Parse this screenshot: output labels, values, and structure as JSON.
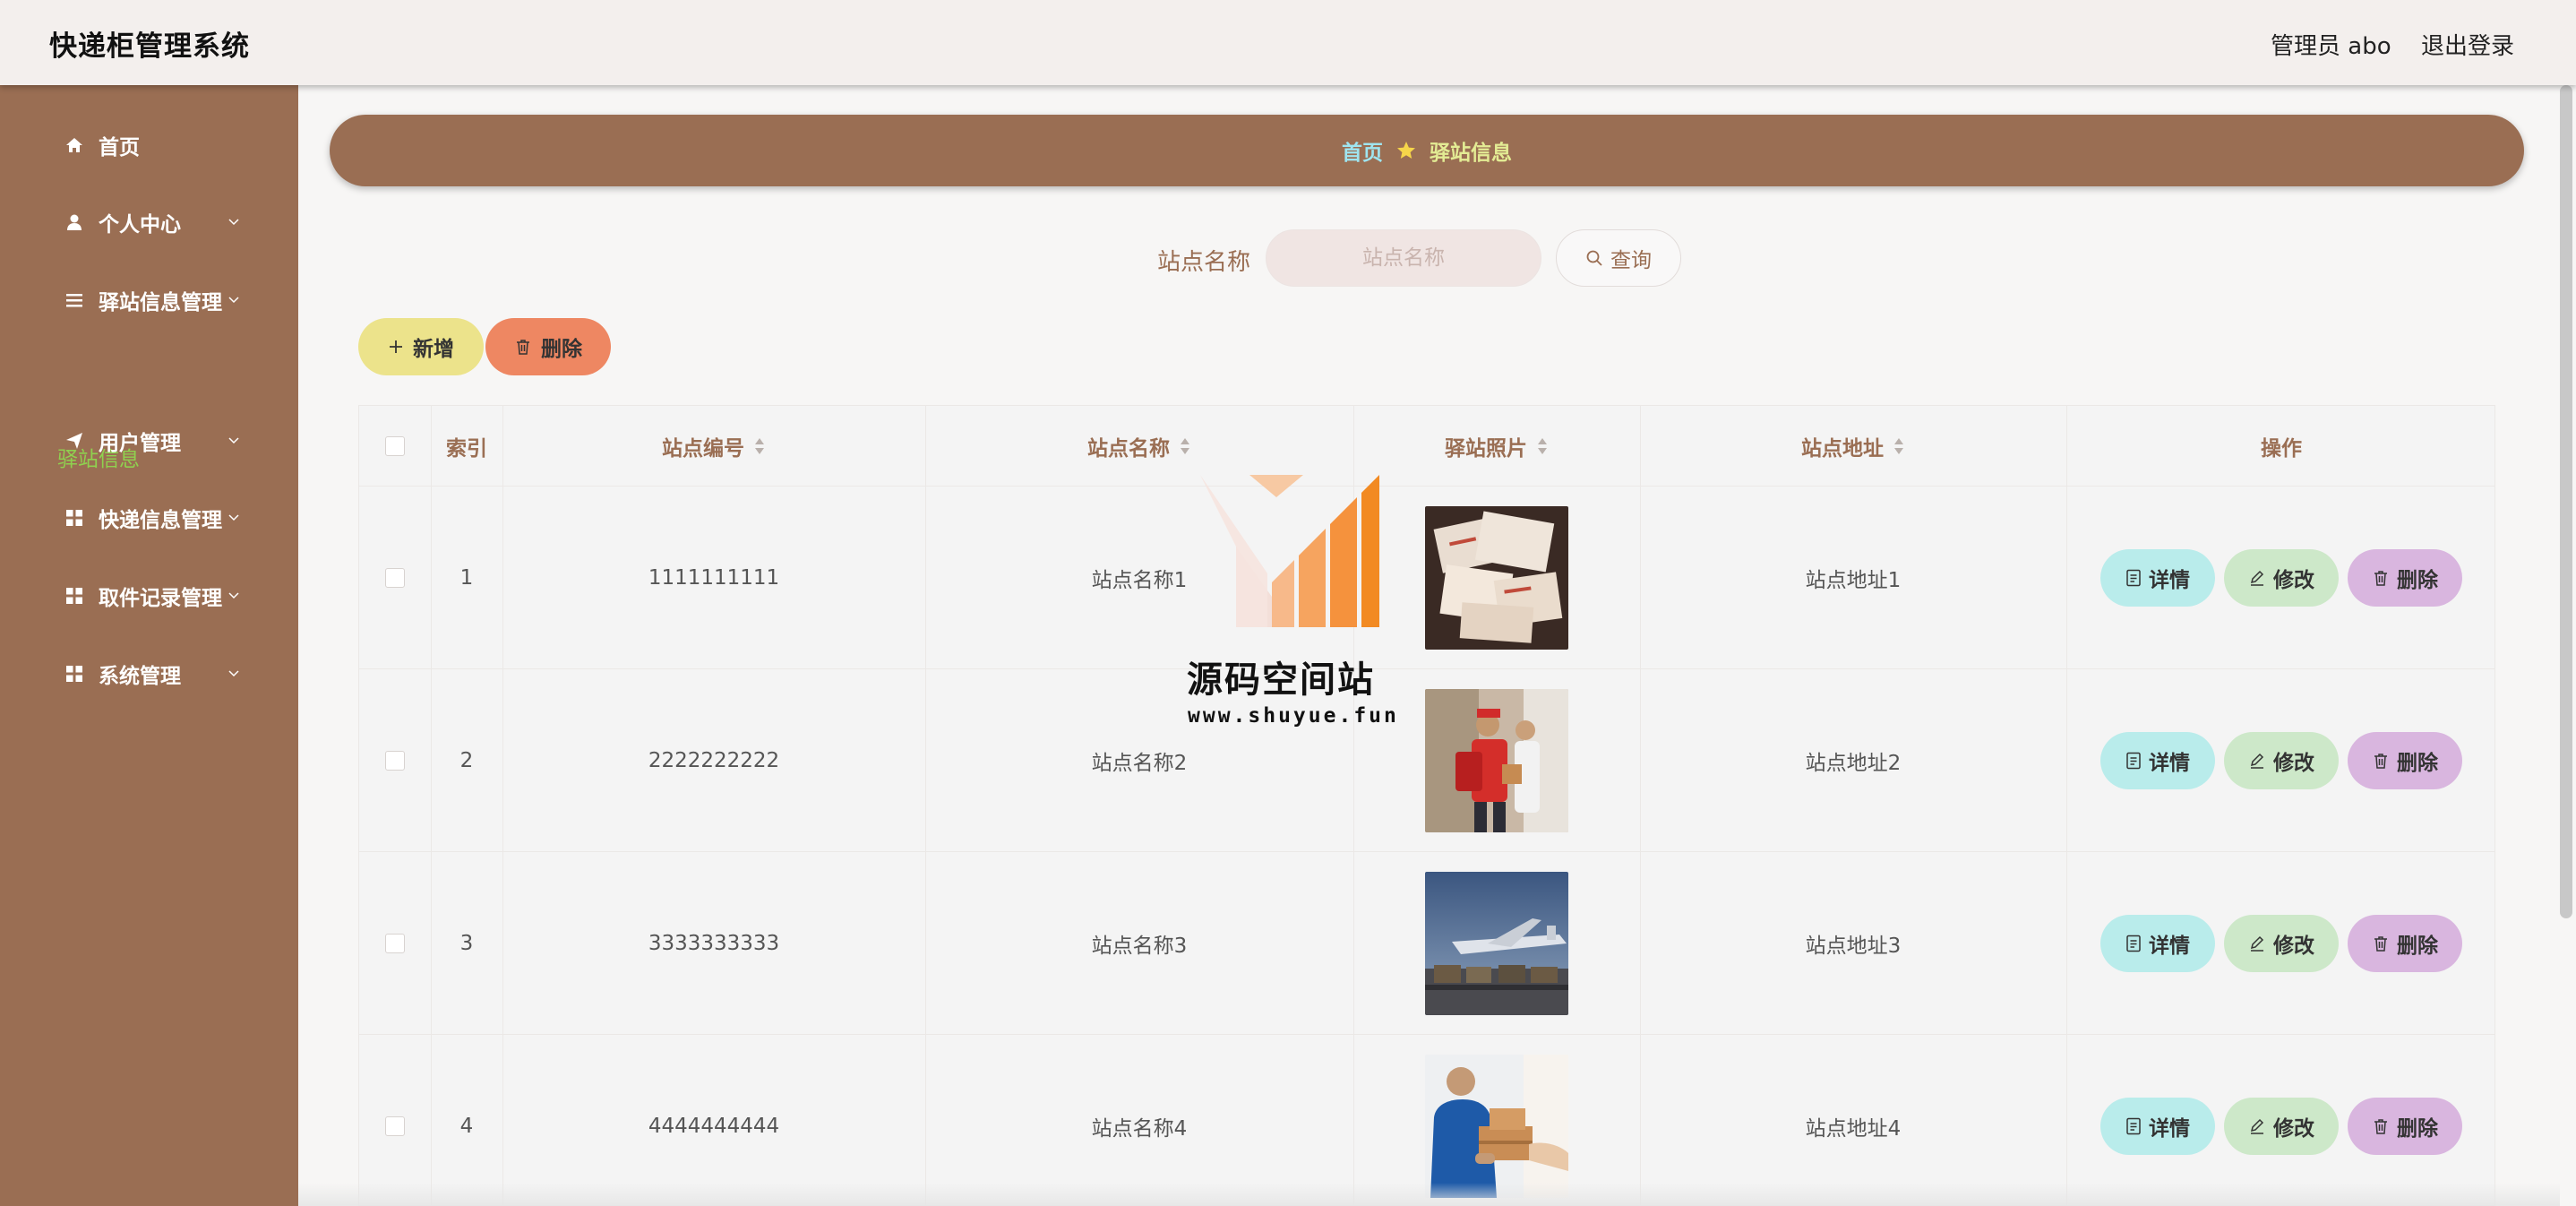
{
  "header": {
    "title": "快递柜管理系统",
    "admin": "管理员 abo",
    "logout": "退出登录"
  },
  "sidebar": {
    "items": [
      {
        "label": "首页",
        "icon": "home-icon",
        "chevron": false
      },
      {
        "label": "个人中心",
        "icon": "user-icon",
        "chevron": true
      },
      {
        "label": "驿站信息管理",
        "icon": "list-icon",
        "chevron": true
      },
      {
        "label": "用户管理",
        "icon": "send-icon",
        "chevron": true
      },
      {
        "label": "快递信息管理",
        "icon": "grid-icon",
        "chevron": true
      },
      {
        "label": "取件记录管理",
        "icon": "grid-icon",
        "chevron": true
      },
      {
        "label": "系统管理",
        "icon": "grid-icon",
        "chevron": true
      }
    ],
    "active_sub": "驿站信息",
    "active_sub_color": "#8fd14f"
  },
  "breadcrumb": {
    "home": "首页",
    "current": "驿站信息"
  },
  "search": {
    "label": "站点名称",
    "placeholder": "站点名称",
    "button": "查询"
  },
  "toolbar": {
    "add": "新增",
    "delete": "删除"
  },
  "table": {
    "headers": {
      "index": "索引",
      "code": "站点编号",
      "name": "站点名称",
      "photo": "驿站照片",
      "address": "站点地址",
      "actions": "操作"
    },
    "rows": [
      {
        "index": "1",
        "code": "1111111111",
        "name": "站点名称1",
        "address": "站点地址1",
        "photo": "parcels-photo"
      },
      {
        "index": "2",
        "code": "2222222222",
        "name": "站点名称2",
        "address": "站点地址2",
        "photo": "courier-photo"
      },
      {
        "index": "3",
        "code": "3333333333",
        "name": "站点名称3",
        "address": "站点地址3",
        "photo": "airport-cargo-photo"
      },
      {
        "index": "4",
        "code": "4444444444",
        "name": "站点名称4",
        "address": "站点地址4",
        "photo": "delivery-handover-photo"
      }
    ],
    "actions": {
      "detail": "详情",
      "edit": "修改",
      "delete": "删除"
    }
  },
  "watermark": {
    "title": "源码空间站",
    "url": "www.shuyue.fun"
  },
  "colors": {
    "brand": "#9a6e53",
    "add": "#ece38b",
    "delete": "#ee8762",
    "detail": "#b9eceb",
    "edit": "#cde8c9",
    "row_delete": "#d9b6df"
  }
}
